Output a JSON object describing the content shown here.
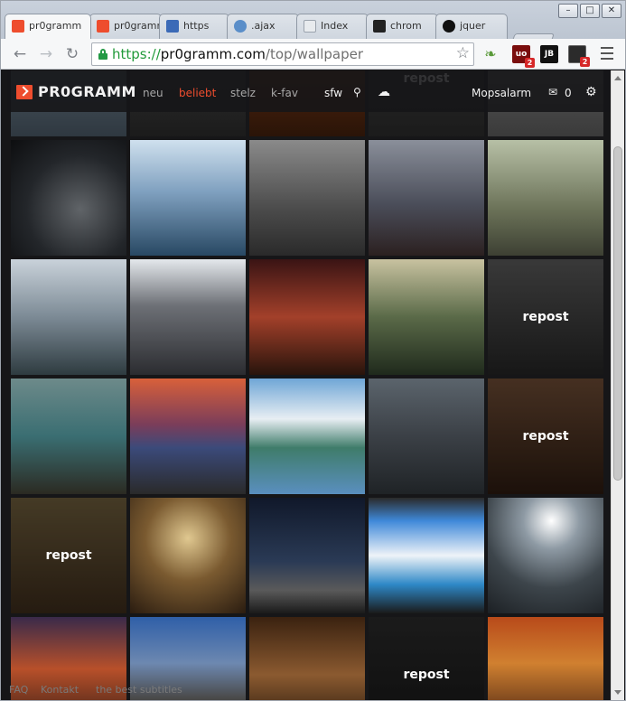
{
  "browser": {
    "tabs": [
      {
        "label": "pr0gramm",
        "active": true,
        "favicon_color": "#ee4d2e"
      },
      {
        "label": "pr0gramm",
        "active": false,
        "favicon_color": "#ee4d2e"
      },
      {
        "label": "https",
        "active": false,
        "favicon_color": "#3b6ab7"
      },
      {
        "label": ".ajax",
        "active": false,
        "favicon_color": "#5a8ec9"
      },
      {
        "label": "Index",
        "active": false,
        "favicon_color": "#9ba3ad"
      },
      {
        "label": "chrom",
        "active": false,
        "favicon_color": "#222222"
      },
      {
        "label": "jquer",
        "active": false,
        "favicon_color": "#111111"
      }
    ],
    "url": {
      "scheme": "https://",
      "host": "pr0gramm.com",
      "path": "/top/wallpaper"
    },
    "extensions": [
      {
        "name": "leaf-icon",
        "label": "",
        "color": "#6aa84f"
      },
      {
        "name": "ublock-icon",
        "label": "uo",
        "color": "#7a0d0d",
        "badge": "2"
      },
      {
        "name": "jb-icon",
        "label": "JB",
        "color": "#111111"
      },
      {
        "name": "ext-icon",
        "label": "",
        "color": "#2b2b2b",
        "badge": "2"
      }
    ],
    "window_controls": [
      "–",
      "□",
      "✕"
    ]
  },
  "site": {
    "logo": "PR0GRAMM",
    "nav": [
      {
        "label": "neu",
        "active": false
      },
      {
        "label": "beliebt",
        "active": true
      },
      {
        "label": "stelz",
        "active": false
      },
      {
        "label": "k-fav",
        "active": false
      }
    ],
    "sfw": "sfw",
    "user": "Mopsalarm",
    "inbox_count": "0",
    "repost_label": "repost",
    "footer": [
      "FAQ",
      "Kontakt",
      "the best subtitles"
    ],
    "accent": "#ee4d2e"
  },
  "grid": {
    "rows": [
      [
        {
          "name": "wallpaper-tile",
          "repost": false,
          "bg": "linear-gradient(#5b6a75, #2f3840)"
        },
        {
          "name": "wallpaper-tile",
          "repost": false,
          "bg": "linear-gradient(#3a3a3a, #1b1b1b)"
        },
        {
          "name": "wallpaper-tile",
          "repost": false,
          "bg": "linear-gradient(#6b2f10, #2a1408)"
        },
        {
          "name": "wallpaper-tile",
          "repost": true,
          "bg": "linear-gradient(#4a4a4a, #2a2a2a)"
        },
        {
          "name": "wallpaper-tile",
          "repost": false,
          "bg": "linear-gradient(#6a6a6a, #3a3a3a)"
        }
      ],
      [
        {
          "name": "wallpaper-tile",
          "repost": false,
          "bg": "radial-gradient(circle at 60% 60%, #606468 0%, #23262a 55%, #0d0e10 100%)"
        },
        {
          "name": "wallpaper-tile",
          "repost": false,
          "bg": "linear-gradient(#cfe0ee, #7fa0bf 45%, #284863 100%)"
        },
        {
          "name": "wallpaper-tile",
          "repost": false,
          "bg": "linear-gradient(#8a8a8a, #4b4b4b 60%, #2a2a2a)"
        },
        {
          "name": "wallpaper-tile",
          "repost": false,
          "bg": "linear-gradient(#8a8f9a, #4b4e5a 55%, #2b2020)"
        },
        {
          "name": "wallpaper-tile",
          "repost": false,
          "bg": "linear-gradient(#b7c0a6, #6b7258 60%, #3d4033)"
        }
      ],
      [
        {
          "name": "wallpaper-tile",
          "repost": false,
          "bg": "linear-gradient(#c9d2da, #7c8a95 50%, #2e3b40)"
        },
        {
          "name": "wallpaper-tile",
          "repost": false,
          "bg": "linear-gradient(#e4e8ec, #6d7076 40%, #2b2c30)"
        },
        {
          "name": "wallpaper-tile",
          "repost": false,
          "bg": "linear-gradient(#3a1414, #a3402a 50%, #28140c)"
        },
        {
          "name": "wallpaper-tile",
          "repost": false,
          "bg": "linear-gradient(#c8c2a0, #5a6a48 50%, #1f2a1c)"
        },
        {
          "name": "wallpaper-tile",
          "repost": true,
          "bg": "linear-gradient(#585858, #242424)"
        }
      ],
      [
        {
          "name": "wallpaper-tile",
          "repost": false,
          "bg": "linear-gradient(#6d8a8a, #3a6e72 50%, #2b2a22)"
        },
        {
          "name": "wallpaper-tile",
          "repost": false,
          "bg": "linear-gradient(#d8603a, #7a3d5a 40%, #3b4a7a 60%, #2a2a2a)"
        },
        {
          "name": "wallpaper-tile",
          "repost": false,
          "bg": "linear-gradient(#6fa6d6, #e8eef3 35%, #3f7c6a 60%, #5a8fbf)"
        },
        {
          "name": "wallpaper-tile",
          "repost": false,
          "bg": "linear-gradient(#5b646c, #3b4046 50%, #1f2326)"
        },
        {
          "name": "wallpaper-tile",
          "repost": true,
          "bg": "linear-gradient(#6b4a34, #2b1a10)"
        }
      ],
      [
        {
          "name": "wallpaper-tile",
          "repost": true,
          "bg": "linear-gradient(#6a5a3a, #3a2a1a)"
        },
        {
          "name": "wallpaper-tile",
          "repost": false,
          "bg": "radial-gradient(circle at 50% 35%, #e0c890 0%, #7a5a30 45%, #2a1c10 100%)"
        },
        {
          "name": "wallpaper-tile",
          "repost": false,
          "bg": "linear-gradient(#10182a, #2a3a55 55%, #5a5a5a 80%, #1a1a1a)"
        },
        {
          "name": "wallpaper-tile",
          "repost": false,
          "bg": "linear-gradient(#2a2a2a, #3f89d9 20%, #eef3f8 50%, #2e88c7 75%, #1a1a1a)"
        },
        {
          "name": "wallpaper-tile",
          "repost": false,
          "bg": "radial-gradient(circle at 55% 20%, #ffffff 0%, #8e9aa4 25%, #3d454b 60%, #1c2024 100%)"
        }
      ],
      [
        {
          "name": "wallpaper-tile",
          "repost": false,
          "bg": "linear-gradient(#3a2a4a, #b8502a 45%, #2a1a14)"
        },
        {
          "name": "wallpaper-tile",
          "repost": false,
          "bg": "linear-gradient(#2f5fa8, #6d88b0 40%, #4a4a4a 70%, #2a2a2a)"
        },
        {
          "name": "wallpaper-tile",
          "repost": false,
          "bg": "linear-gradient(#3a2210, #8b5a30 50%, #1e140a)"
        },
        {
          "name": "wallpaper-tile",
          "repost": true,
          "bg": "linear-gradient(#2a2a2a, #161616)"
        },
        {
          "name": "wallpaper-tile",
          "repost": false,
          "bg": "linear-gradient(#b84a1a, #d08030 40%, #3a1a10)"
        }
      ]
    ]
  }
}
